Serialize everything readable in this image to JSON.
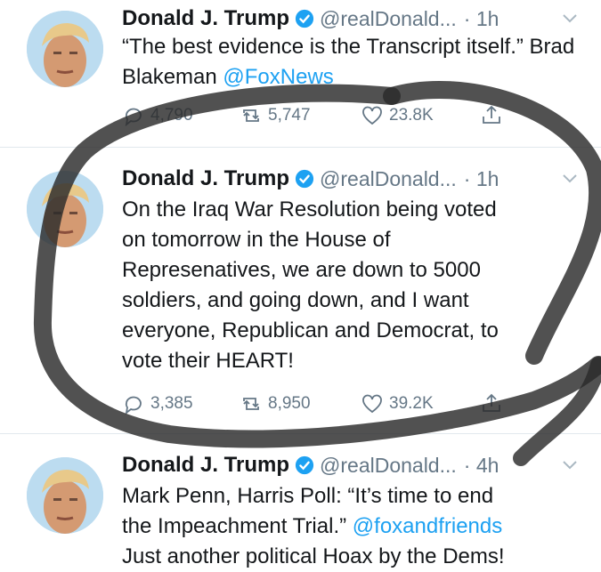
{
  "tweets": [
    {
      "name": "Donald J. Trump",
      "handle": "@realDonald...",
      "time": "· 1h",
      "text_a": "“The best evidence is the Transcript itself.” Brad Blakeman ",
      "link": "@FoxNews",
      "text_b": "",
      "replies": "4,790",
      "retweets": "5,747",
      "likes": "23.8K"
    },
    {
      "name": "Donald J. Trump",
      "handle": "@realDonald...",
      "time": "· 1h",
      "text_a": "On the Iraq War Resolution being voted\non tomorrow in the House of\nRepresenatives, we are down to 5000\nsoldiers, and going down, and I want\neveryone, Republican and Democrat, to\nvote their HEART!",
      "link": "",
      "text_b": "",
      "replies": "3,385",
      "retweets": "8,950",
      "likes": "39.2K"
    },
    {
      "name": "Donald J. Trump",
      "handle": "@realDonald...",
      "time": "· 4h",
      "text_a": "Mark Penn, Harris Poll: “It’s time to end\nthe Impeachment Trial.” ",
      "link": "@foxandfriends",
      "text_b": "\nJust another political Hoax by the Dems!"
    }
  ],
  "colors": {
    "link": "#1da1f2",
    "verified": "#1da1f2",
    "meta": "#657786",
    "scribble": "#2b2b2b"
  },
  "icons": [
    "verified-badge-icon",
    "chevron-down-icon",
    "reply-icon",
    "retweet-icon",
    "like-icon",
    "share-icon"
  ]
}
